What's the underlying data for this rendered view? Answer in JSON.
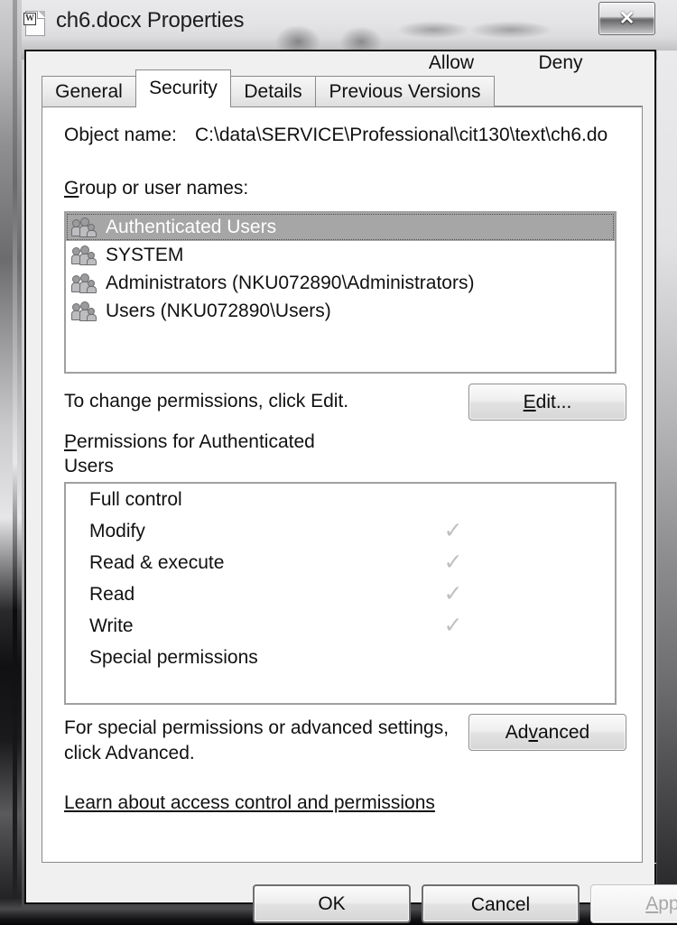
{
  "window": {
    "title": "ch6.docx Properties",
    "app_icon": "word-document-icon",
    "icon_letter": "W",
    "close_label": "✕"
  },
  "tabs": [
    {
      "label": "General",
      "active": false
    },
    {
      "label": "Security",
      "active": true
    },
    {
      "label": "Details",
      "active": false
    },
    {
      "label": "Previous Versions",
      "active": false
    }
  ],
  "security": {
    "object_name_label": "Object name:",
    "object_name_value": "C:\\data\\SERVICE\\Professional\\cit130\\text\\ch6.do",
    "group_label": "Group or user names:",
    "users": [
      {
        "name": "Authenticated Users",
        "selected": true
      },
      {
        "name": "SYSTEM",
        "selected": false
      },
      {
        "name": "Administrators (NKU072890\\Administrators)",
        "selected": false
      },
      {
        "name": "Users (NKU072890\\Users)",
        "selected": false
      }
    ],
    "change_permissions_text": "To change permissions, click Edit.",
    "edit_button": "Edit...",
    "permissions_for_line1": "Permissions for Authenticated",
    "permissions_for_line2": "Users",
    "column_allow": "Allow",
    "column_deny": "Deny",
    "permissions": [
      {
        "name": "Full control",
        "allow": "",
        "deny": ""
      },
      {
        "name": "Modify",
        "allow": "✓",
        "deny": ""
      },
      {
        "name": "Read & execute",
        "allow": "✓",
        "deny": ""
      },
      {
        "name": "Read",
        "allow": "✓",
        "deny": ""
      },
      {
        "name": "Write",
        "allow": "✓",
        "deny": ""
      },
      {
        "name": "Special permissions",
        "allow": "",
        "deny": ""
      }
    ],
    "special_text_line1": "For special permissions or advanced settings,",
    "special_text_line2": "click Advanced.",
    "advanced_button": "Advanced",
    "learn_link": "Learn about access control and permissions"
  },
  "footer": {
    "ok": "OK",
    "cancel": "Cancel",
    "apply": "Apply",
    "apply_disabled": true
  },
  "colors": {
    "dialog_bg": "#f0f0f0",
    "selection": "#a6a6a6",
    "check_gray": "#c0c0c2",
    "text": "#111113"
  }
}
